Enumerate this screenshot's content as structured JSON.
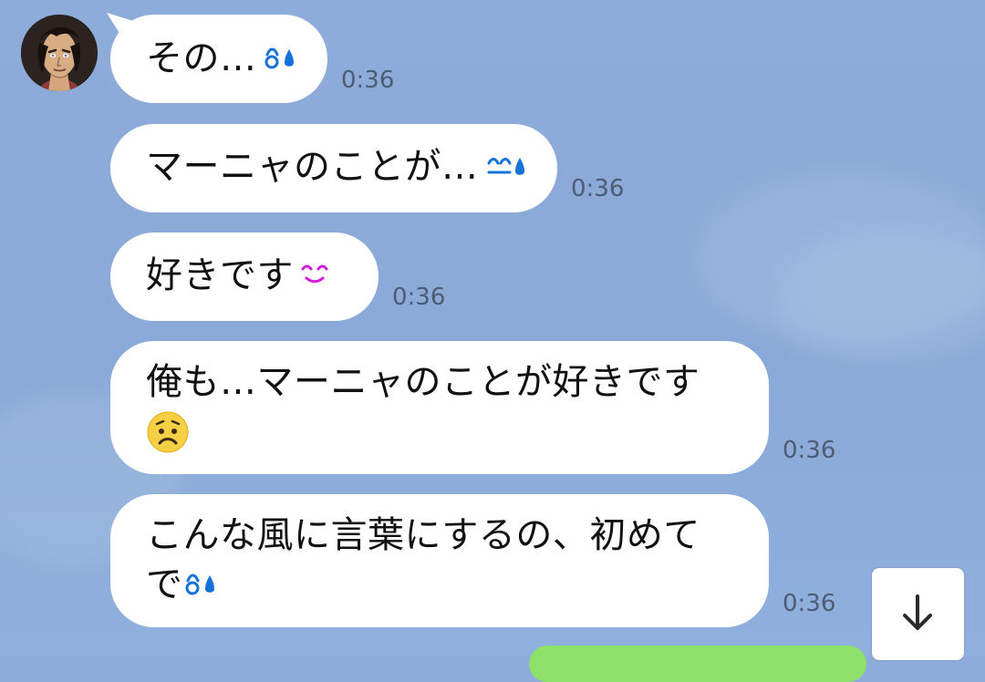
{
  "chat": {
    "avatar": {
      "icon": "person-avatar-icon"
    },
    "messages": [
      {
        "text": "その…",
        "time": "0:36",
        "emoji_icon": "sweat-emoji-icon"
      },
      {
        "text": "マーニャのことが…",
        "time": "0:36",
        "emoji_icon": "sweat-emoji-icon"
      },
      {
        "text": "好きです",
        "time": "0:36",
        "emoji_icon": "happy-eyes-emoji-icon"
      },
      {
        "line1": "俺も…マーニャのことが好きです",
        "time": "0:36",
        "emoji_icon": "worried-face-emoji-icon"
      },
      {
        "line1": "こんな風に言葉にするの、初めて",
        "line2": "で",
        "time": "0:36",
        "emoji_icon": "sweat-emoji-icon"
      }
    ],
    "scroll_button": {
      "icon": "down-arrow-icon"
    },
    "colors": {
      "background": "#8eacd9",
      "incoming_bubble": "#ffffff",
      "outgoing_bubble": "#8de16b",
      "time_text": "#4d5c73"
    }
  }
}
